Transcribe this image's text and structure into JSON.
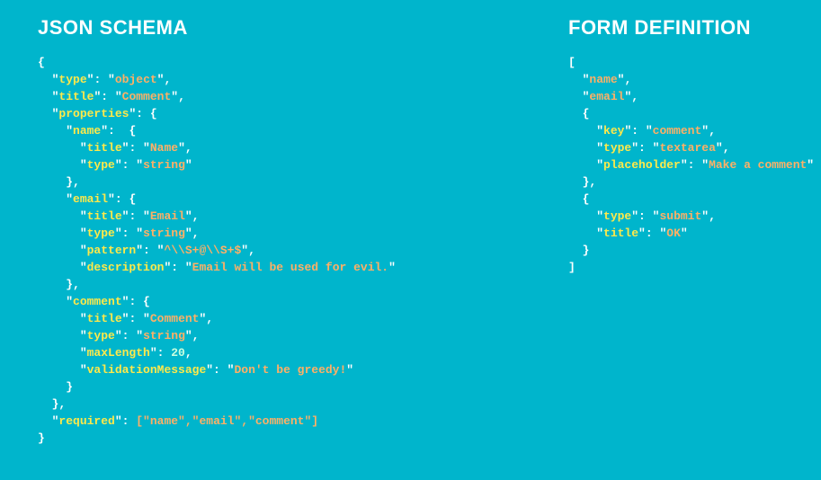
{
  "headings": {
    "left": "JSON SCHEMA",
    "right": "FORM DEFINITION"
  },
  "json_schema": {
    "type": "object",
    "title": "Comment",
    "properties": {
      "name": {
        "title": "Name",
        "type": "string"
      },
      "email": {
        "title": "Email",
        "type": "string",
        "pattern": "^\\\\S+@\\\\S+$",
        "description": "Email will be used for evil."
      },
      "comment": {
        "title": "Comment",
        "type": "string",
        "maxLength": 20,
        "validationMessage": "Don't be greedy!"
      }
    },
    "required": [
      "name",
      "email",
      "comment"
    ]
  },
  "form_definition": [
    "name",
    "email",
    {
      "key": "comment",
      "type": "textarea",
      "placeholder": "Make a comment"
    },
    {
      "type": "submit",
      "title": "OK"
    }
  ],
  "tokens": {
    "lbrace": "{",
    "rbrace": "}",
    "lbracket": "[",
    "rbracket": "]",
    "colon": ": ",
    "comma": ",",
    "q": "\"",
    "type": "type",
    "title": "title",
    "properties": "properties",
    "name": "name",
    "email": "email",
    "comment": "comment",
    "pattern": "pattern",
    "description": "description",
    "maxLength": "maxLength",
    "validationMessage": "validationMessage",
    "required": "required",
    "key": "key",
    "placeholder": "placeholder",
    "object": "object",
    "Comment": "Comment",
    "Name": "Name",
    "string": "string",
    "Email": "Email",
    "patternValue": "^\\\\S+@\\\\S+$",
    "emailDesc": "Email will be used for evil.",
    "twenty": "20",
    "greedy": "Don't be greedy!",
    "reqArray": "[\"name\",\"email\",\"comment\"]",
    "textarea": "textarea",
    "makeComment": "Make a comment",
    "submit": "submit",
    "OK": "OK"
  }
}
